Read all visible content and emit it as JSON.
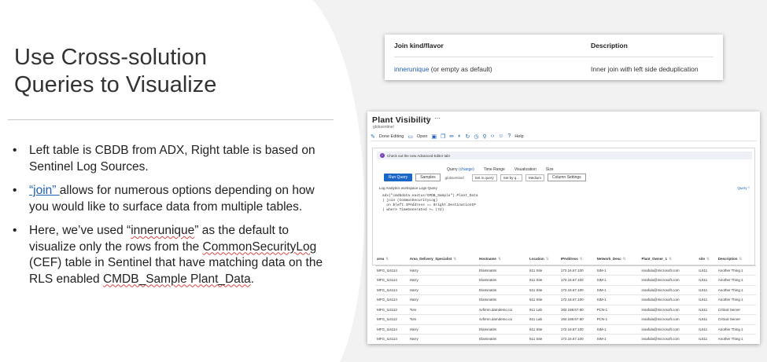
{
  "slide": {
    "title_line1": "Use Cross-solution",
    "title_line2": "Queries to Visualize",
    "bullet1": "Left table is CBDB from ADX, Right table is based on Sentinel Log Sources.",
    "bullet2_link": "“join” ",
    "bullet2_rest": "allows for numerous options depending on how you would like to surface data from multiple tables.",
    "bullet3_a": "Here, we’ve used “",
    "bullet3_word": "innerunique",
    "bullet3_b": "” as the default to visualize only the rows from the ",
    "bullet3_word2": "CommonSecurityLog",
    "bullet3_c": " (CEF) table in Sentinel that have matching data on the RLS enabled ",
    "bullet3_word3": "CMDB_Sample Plant_Data",
    "bullet3_d": "."
  },
  "join_table": {
    "header_kind": "Join kind/flavor",
    "header_desc": "Description",
    "row_kind_link": "innerunique",
    "row_kind_rest": " (or empty as default)",
    "row_desc": "Inner join with left side deduplication"
  },
  "workbook": {
    "title": "Plant Visibility",
    "subtitle": "globsentinel",
    "toolbar": {
      "done_editing": "Done Editing",
      "open": "Open",
      "help": "Help"
    },
    "notice": "Check out the new Advanced Editor tab!",
    "labels": {
      "query": "Query",
      "change": "(change)",
      "time_range": "Time Range",
      "visualization": "Visualization",
      "size": "Size"
    },
    "buttons": {
      "run_query": "Run Query",
      "samples": "Samples",
      "column_settings": "Column Settings"
    },
    "workspace": "globsentinel",
    "selects": {
      "time_range": "Set in query",
      "visualization": "Set by q...",
      "size": "Medium"
    },
    "query_title": "Log Analytics workspace Logs Query",
    "query_link": "Query ^",
    "code": [
      "adx(\"cmdbdata.eastus/CMDB_Sample\").Plant_Data",
      "| join (CommonSecurityLog)",
      "  on $left.IPAddress == $right.DestinationIP",
      "| where TimeGenerated >= (7d)"
    ],
    "columns": [
      "area",
      "Area_Delivery_Specialist",
      "Hostname",
      "Location",
      "IPAddress",
      "Network_Desc",
      "Plant_Owner_1",
      "site",
      "Description"
    ],
    "rows": [
      [
        "MFG_IL6114",
        "Harry",
        "Elaminatim",
        "611 Site",
        "172.16.67.100",
        "SIM-1",
        "insafula@microsoft.com",
        "IL611",
        "Another Thing 1"
      ],
      [
        "MFG_IL6114",
        "Harry",
        "Elaminatim",
        "611 Site",
        "172.16.67.100",
        "SIM-1",
        "insafula@microsoft.com",
        "IL611",
        "Another Thing 1"
      ],
      [
        "MFG_IL6114",
        "Harry",
        "Elaminatim",
        "611 Site",
        "172.16.67.100",
        "SIM-1",
        "insafula@microsoft.com",
        "IL611",
        "Another Thing 1"
      ],
      [
        "MFG_IL6114",
        "Harry",
        "Elaminatim",
        "611 Site",
        "172.16.67.100",
        "SIM-1",
        "insafula@microsoft.com",
        "IL611",
        "Another Thing 1"
      ],
      [
        "MFG_IL6112",
        "Tom",
        "svfirmn.damdemo.ca",
        "611 Lab",
        "192.168.67.80",
        "PCN-1",
        "insafula@microsoft.com",
        "IL611",
        "Critical Server"
      ],
      [
        "MFG_IL6112",
        "Tom",
        "svfirmn.damdemo.ca",
        "611 Lab",
        "192.168.67.80",
        "PCN-1",
        "insafula@microsoft.com",
        "IL611",
        "Critical Server"
      ],
      [
        "MFG_IL6114",
        "Harry",
        "Elaminatim",
        "611 Site",
        "172.16.67.100",
        "SIM-1",
        "insafula@microsoft.com",
        "IL611",
        "Another Thing 1"
      ],
      [
        "MFG_IL6114",
        "Harry",
        "Elaminatim",
        "611 Site",
        "172.16.67.100",
        "SIM-1",
        "insafula@microsoft.com",
        "IL611",
        "Another Thing 1"
      ]
    ]
  }
}
